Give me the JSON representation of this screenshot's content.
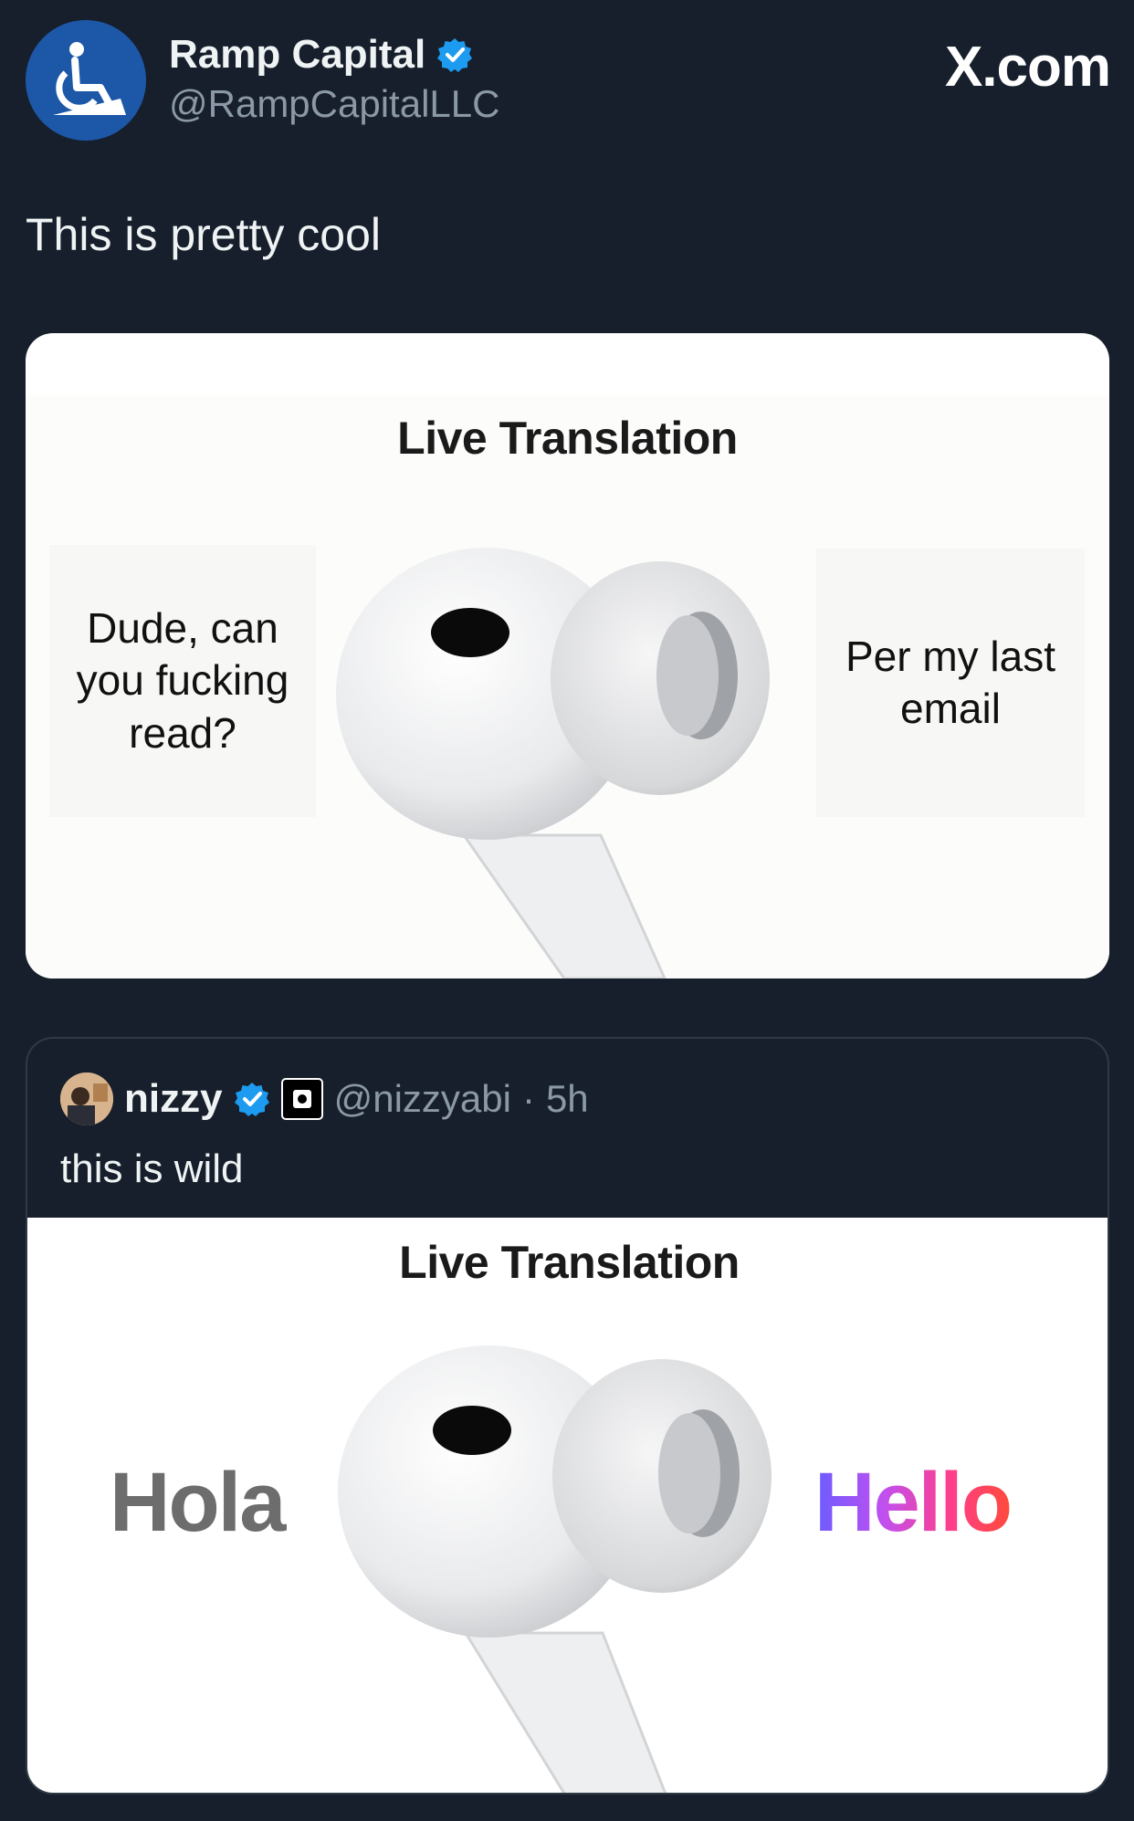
{
  "post": {
    "display_name": "Ramp Capital",
    "handle": "@RampCapitalLLC",
    "watermark": "X.com",
    "text": "This is pretty cool",
    "avatar_icon": "wheelchair-icon",
    "verified": true
  },
  "media": {
    "title": "Live Translation",
    "left_text": "Dude, can you fucking read?",
    "right_text": "Per my last email"
  },
  "quote": {
    "display_name": "nizzy",
    "handle": "@nizzyabi",
    "time": "5h",
    "separator": "·",
    "text": "this is wild",
    "media_title": "Live Translation",
    "left_word": "Hola",
    "right_word": "Hello"
  },
  "colors": {
    "background": "#161f2b",
    "verified_blue": "#1d9bf0",
    "secondary_text": "#8b98a5"
  }
}
